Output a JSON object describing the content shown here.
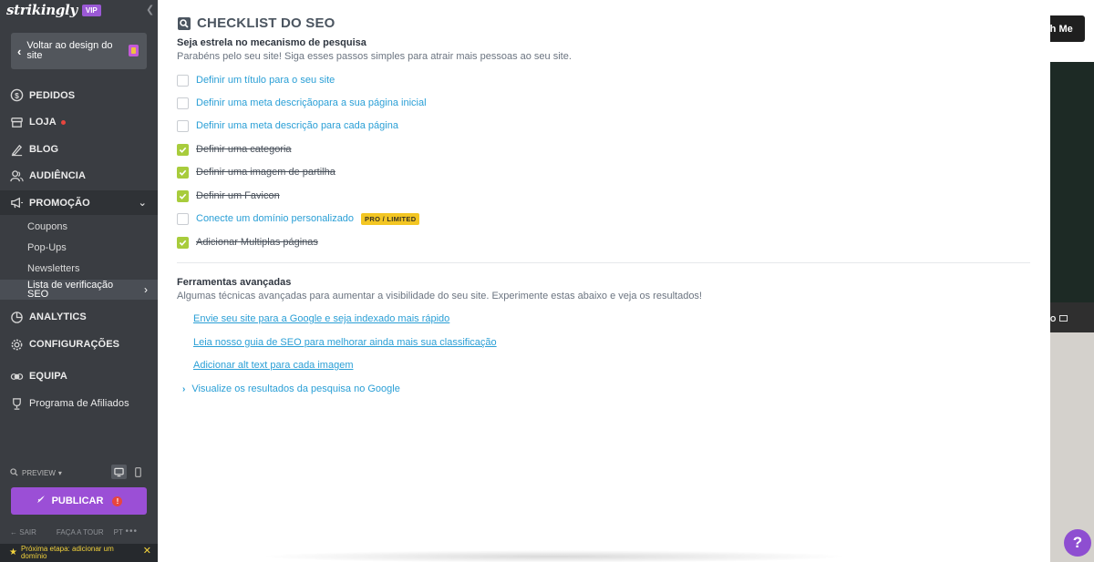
{
  "sidebar": {
    "logo": "strikingly",
    "vip_badge": "VIP",
    "back_button": "Voltar ao design do site",
    "nav": [
      {
        "id": "pedidos",
        "label": "PEDIDOS",
        "icon": "dollar-icon"
      },
      {
        "id": "loja",
        "label": "LOJA",
        "icon": "store-icon",
        "notification_dot": "#e8463e"
      },
      {
        "id": "blog",
        "label": "BLOG",
        "icon": "pen-icon"
      },
      {
        "id": "audiencia",
        "label": "AUDIÊNCIA",
        "icon": "users-icon"
      },
      {
        "id": "promocao",
        "label": "PROMOÇÃO",
        "icon": "megaphone-icon",
        "expanded": true
      },
      {
        "id": "analytics",
        "label": "ANALYTICS",
        "icon": "pie-chart-icon"
      },
      {
        "id": "configuracoes",
        "label": "CONFIGURAÇÕES",
        "icon": "gear-icon"
      },
      {
        "id": "equipa",
        "label": "EQUIPA",
        "icon": "team-icon"
      },
      {
        "id": "afiliados",
        "label": "Programa de Afiliados",
        "icon": "trophy-icon"
      }
    ],
    "promo_sub": [
      "Coupons",
      "Pop-Ups",
      "Newsletters"
    ],
    "promo_active": "Lista de verificação SEO",
    "preview_label": "PREVIEW",
    "publish_label": "PUBLICAR",
    "footer": {
      "exit": "SAIR",
      "tour": "FAÇA A TOUR",
      "lang": "PT",
      "more": "•••"
    },
    "next_step": "Próxima etapa: adicionar um domínio"
  },
  "panel": {
    "title": "CHECKLIST DO SEO",
    "section1": {
      "heading": "Seja estrela no mecanismo de pesquisa",
      "description": "Parabéns pelo seu site! Siga esses passos simples para atrair mais pessoas ao seu site."
    },
    "checklist": [
      {
        "label": "Definir um título para o seu site",
        "done": false
      },
      {
        "label": "Definir uma meta descriçãopara a sua página inicial",
        "done": false
      },
      {
        "label": "Definir uma meta descrição para cada página",
        "done": false
      },
      {
        "label": "Definir uma categoria",
        "done": true
      },
      {
        "label": "Definir uma imagem de partilha",
        "done": true
      },
      {
        "label": "Definir um Favicon",
        "done": true
      },
      {
        "label": "Conecte um domínio personalizado",
        "done": false,
        "badge": "PRO / LIMITED"
      },
      {
        "label": "Adicionar Multiplas páginas",
        "done": true
      }
    ],
    "section2": {
      "heading": "Ferramentas avançadas",
      "description": "Algumas técnicas avançadas para aumentar a visibilidade do seu site. Experimente estas abaixo e veja os resultados!"
    },
    "advanced_links": [
      "Envie seu site para a Google e seja indexado mais rápido",
      "Leia nosso guia de SEO para melhorar ainda mais sua classificação",
      "Adicionar alt text para cada imagem"
    ],
    "expand_link": "Visualize os resultados da pesquisa no Google"
  },
  "background": {
    "top_button": "th Me",
    "stripe_text": "O"
  },
  "help_label": "?",
  "colors": {
    "accent": "#2a9fd6",
    "check": "#a8cc3c",
    "publish": "#9b4fd6",
    "badge": "#f3c623"
  }
}
